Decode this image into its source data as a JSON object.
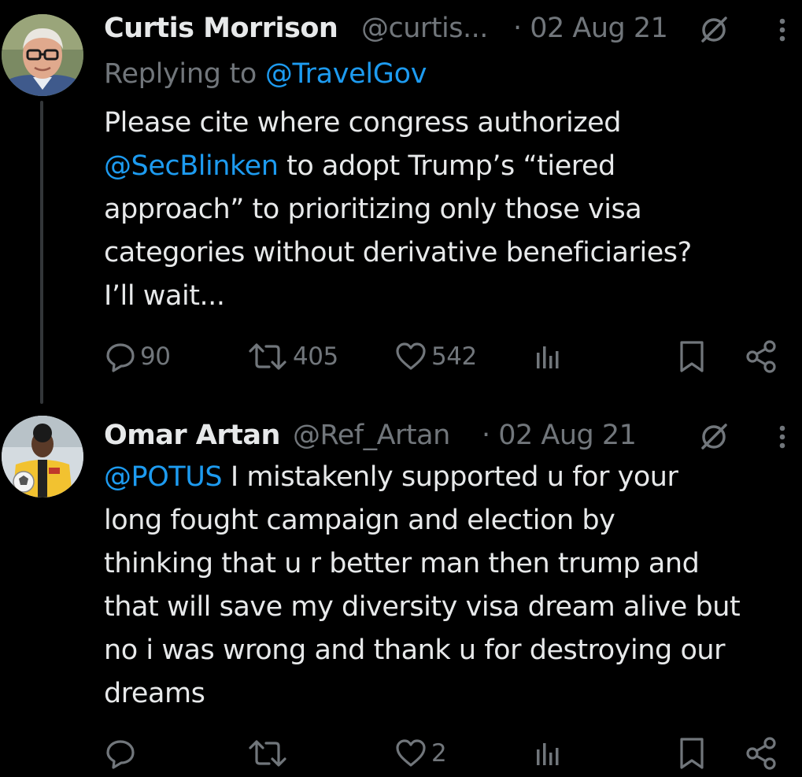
{
  "tweets": [
    {
      "author": "Curtis Morrison",
      "handle": "@curtis...",
      "date": "· 02 Aug 21",
      "replying_prefix": "Replying to",
      "replying_to": "@TravelGov",
      "text_mention": "@SecBlinken",
      "text_before": "Please cite where congress authorized\n",
      "text_after": " to adopt Trump’s “tiered\napproach” to prioritizing only those visa\ncategories without derivative beneficiaries?\nI’ll wait...",
      "stats": {
        "replies": "90",
        "reposts": "405",
        "likes": "542"
      },
      "icons": [
        "mute-icon",
        "more-icon",
        "reply-icon",
        "repost-icon",
        "like-icon",
        "views-icon",
        "bookmark-icon",
        "share-icon"
      ]
    },
    {
      "author": "Omar Artan",
      "handle": "@Ref_Artan",
      "date": "· 02 Aug 21",
      "text_mention": "@POTUS",
      "text_after": " I mistakenly supported u for your\nlong fought campaign and election by\nthinking that u r better man then trump and\nthat will save my diversity visa dream alive but\nno i was wrong and thank u for destroying our\ndreams",
      "stats": {
        "replies": "",
        "reposts": "",
        "likes": "2"
      },
      "icons": [
        "mute-icon",
        "more-icon",
        "reply-icon",
        "repost-icon",
        "like-icon",
        "views-icon",
        "bookmark-icon",
        "share-icon"
      ]
    }
  ],
  "colors": {
    "background": "#000000",
    "text": "#e7e9ea",
    "secondary": "#71767b",
    "link": "#1d9bf0",
    "thread_line": "#333639"
  }
}
